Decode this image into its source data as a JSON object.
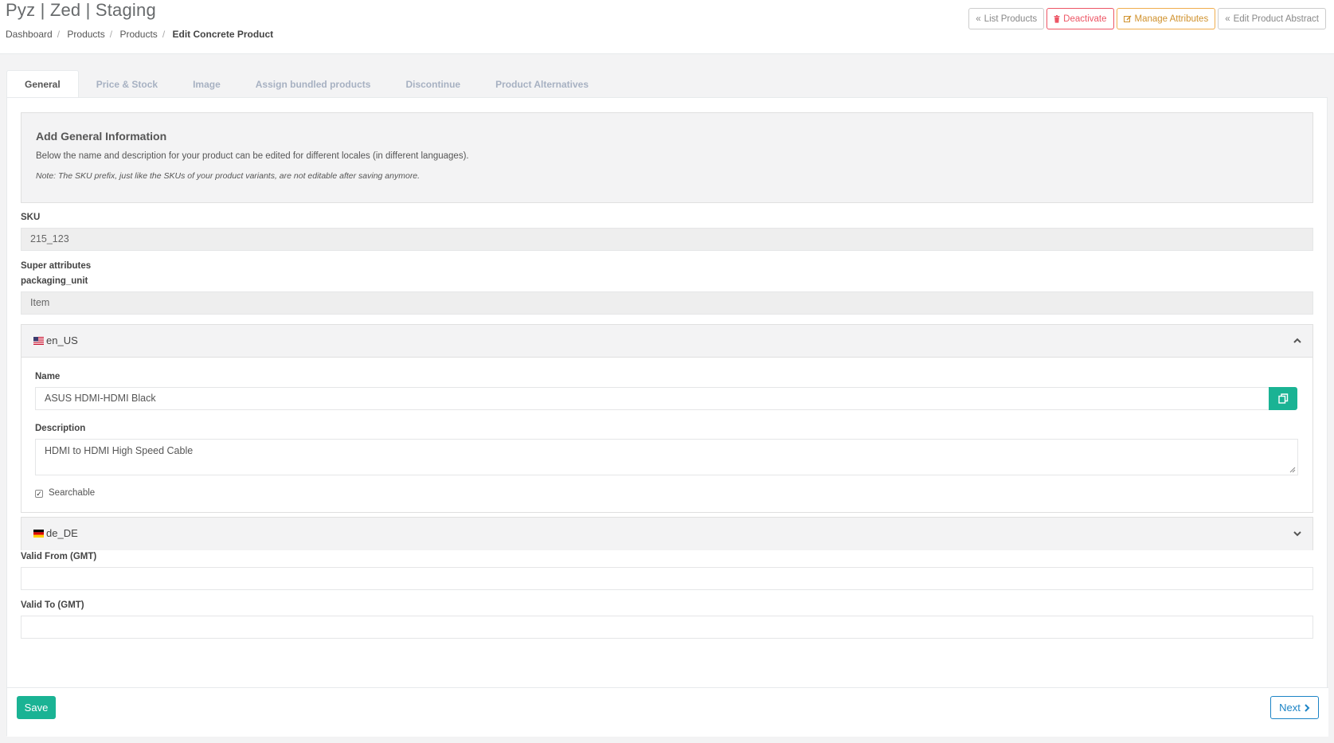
{
  "app": {
    "title": "Pyz | Zed | Staging"
  },
  "breadcrumb": [
    "Dashboard",
    "Products",
    "Products",
    "Edit Concrete Product"
  ],
  "actions": {
    "list_products": "List Products",
    "deactivate": "Deactivate",
    "manage_attributes": "Manage Attributes",
    "edit_product_abstract": "Edit Product Abstract"
  },
  "tabs": [
    "General",
    "Price & Stock",
    "Image",
    "Assign bundled products",
    "Discontinue",
    "Product Alternatives"
  ],
  "info": {
    "title": "Add General Information",
    "text": "Below the name and description for your product can be edited for different locales (in different languages).",
    "note": "Note: The SKU prefix, just like the SKUs of your product variants, are not editable after saving anymore."
  },
  "sku": {
    "label": "SKU",
    "value": "215_123"
  },
  "super_attributes": {
    "label": "Super attributes",
    "attr_label": "packaging_unit",
    "attr_value": "Item"
  },
  "locale_en": {
    "code": "en_US",
    "name_label": "Name",
    "name_value": "ASUS HDMI-HDMI Black",
    "description_label": "Description",
    "description_value": "HDMI to HDMI High Speed Cable",
    "searchable_label": "Searchable",
    "searchable_checked": true
  },
  "locale_de": {
    "code": "de_DE"
  },
  "valid_from": {
    "label": "Valid From (GMT)",
    "value": ""
  },
  "valid_to": {
    "label": "Valid To (GMT)",
    "value": ""
  },
  "footer": {
    "save": "Save",
    "next": "Next"
  },
  "colors": {
    "primary": "#1ab394",
    "danger": "#ed5565",
    "warning": "#f0ad4e",
    "info": "#1c84c6"
  }
}
